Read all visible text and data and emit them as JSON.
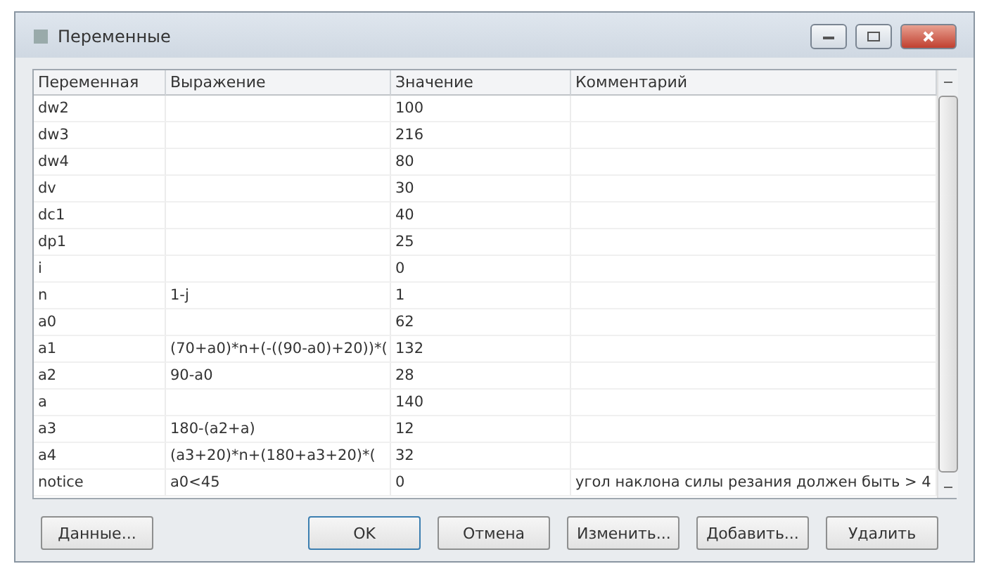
{
  "window": {
    "title": "Переменные"
  },
  "table": {
    "columns": [
      "Переменная",
      "Выражение",
      "Значение",
      "Комментарий"
    ],
    "rows": [
      [
        "dw2",
        "",
        "100",
        ""
      ],
      [
        "dw3",
        "",
        "216",
        ""
      ],
      [
        "dw4",
        "",
        "80",
        ""
      ],
      [
        "dv",
        "",
        "30",
        ""
      ],
      [
        "dc1",
        "",
        "40",
        ""
      ],
      [
        "dp1",
        "",
        "25",
        ""
      ],
      [
        "i",
        "",
        "0",
        ""
      ],
      [
        "n",
        "1-j",
        "1",
        ""
      ],
      [
        "a0",
        "",
        "62",
        ""
      ],
      [
        "a1",
        "(70+a0)*n+(-((90-a0)+20))*(",
        "132",
        ""
      ],
      [
        "a2",
        "90-a0",
        "28",
        ""
      ],
      [
        "a",
        "",
        "140",
        ""
      ],
      [
        "a3",
        "180-(a2+a)",
        "12",
        ""
      ],
      [
        "a4",
        "(a3+20)*n+(180+a3+20)*(",
        "32",
        ""
      ],
      [
        "notice",
        "a0<45",
        "0",
        "угол наклона силы резания должен быть > 4"
      ]
    ]
  },
  "buttons": [
    {
      "label": "Данные...",
      "kind": "left",
      "default": false
    },
    {
      "label": "OK",
      "kind": "right",
      "default": true
    },
    {
      "label": "Отмена",
      "kind": "right",
      "default": false
    },
    {
      "label": "Изменить...",
      "kind": "right",
      "default": false
    },
    {
      "label": "Добавить...",
      "kind": "right",
      "default": false
    },
    {
      "label": "Удалить",
      "kind": "right",
      "default": false
    }
  ]
}
